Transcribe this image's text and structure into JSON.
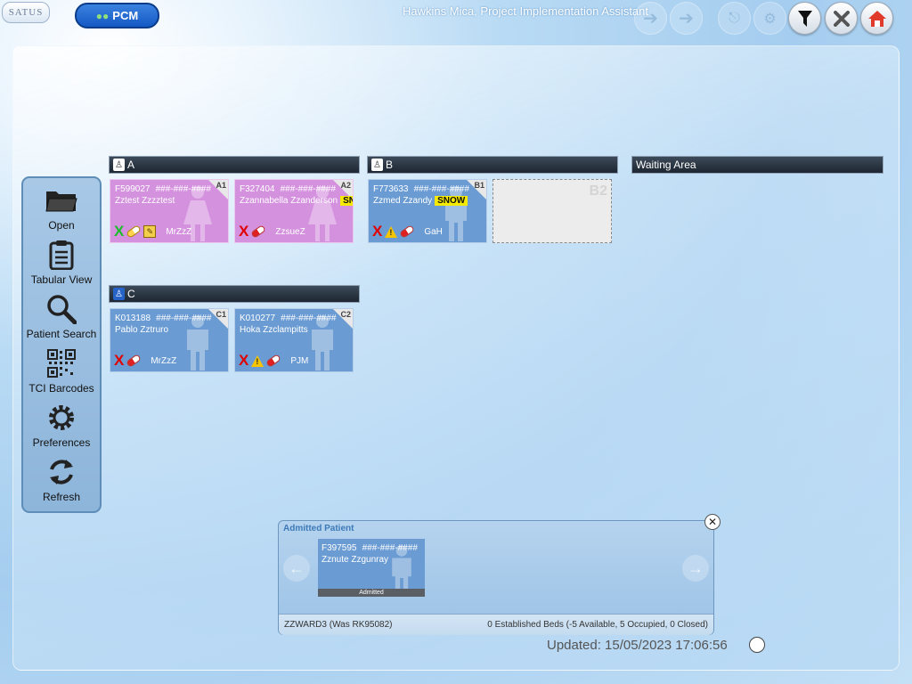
{
  "app": {
    "logo_text": "SATUS",
    "module_button": "PCM",
    "user_title": "Hawkins Mica, Project Implementation Assistant"
  },
  "toolbar": [
    {
      "icon": "back-arrow-icon",
      "state": "disabled"
    },
    {
      "icon": "forward-arrow-icon",
      "state": "disabled"
    },
    {
      "icon": "logout-icon",
      "state": "disabled"
    },
    {
      "icon": "tools-icon",
      "state": "disabled"
    },
    {
      "icon": "filter-icon",
      "state": "enabled"
    },
    {
      "icon": "close-icon",
      "state": "enabled"
    },
    {
      "icon": "home-icon",
      "state": "enabled"
    }
  ],
  "sidemenu": [
    {
      "label": "Open",
      "icon": "folder-icon"
    },
    {
      "label": "Tabular View",
      "icon": "clipboard-icon"
    },
    {
      "label": "Patient Search",
      "icon": "magnifier-icon"
    },
    {
      "label": "TCI Barcodes",
      "icon": "qr-code-icon"
    },
    {
      "label": "Preferences",
      "icon": "gear-icon"
    },
    {
      "label": "Refresh",
      "icon": "refresh-icon"
    }
  ],
  "rooms": {
    "A": {
      "name": "A"
    },
    "B": {
      "name": "B"
    },
    "waiting": {
      "name": "Waiting Area"
    },
    "C": {
      "name": "C"
    }
  },
  "beds": [
    {
      "bed": "A1",
      "mrn": "F599027",
      "nhs": "###-###-####",
      "name": "Zztest Zzzztest",
      "flag": "",
      "consultant": "MrZzZ",
      "gender": "female"
    },
    {
      "bed": "A2",
      "mrn": "F327404",
      "nhs": "###-###-####",
      "name": "Zzannabella Zzanderson",
      "flag": "SN",
      "consultant": "ZzsueZ",
      "gender": "female"
    },
    {
      "bed": "B1",
      "mrn": "F773633",
      "nhs": "###-###-####",
      "name": "Zzmed Zzandy",
      "flag": "SNOW",
      "consultant": "GaH",
      "gender": "male"
    },
    {
      "bed": "B2",
      "mrn": "",
      "nhs": "",
      "name": "",
      "flag": "",
      "consultant": "",
      "gender": "empty"
    },
    {
      "bed": "C1",
      "mrn": "K013188",
      "nhs": "###-###-####",
      "name": "Pablo Zztruro",
      "flag": "",
      "consultant": "MrZzZ",
      "gender": "male"
    },
    {
      "bed": "C2",
      "mrn": "K010277",
      "nhs": "###-###-####",
      "name": "Hoka Zzclampitts",
      "flag": "",
      "consultant": "PJM",
      "gender": "male"
    }
  ],
  "admitted": {
    "title": "Admitted Patient",
    "patient": {
      "mrn": "F397595",
      "nhs": "###-###-####",
      "name": "Zznute Zzgunray",
      "status": "Admitted"
    },
    "ward": "ZZWARD3 (Was RK95082)",
    "summary": "0 Established Beds (-5 Available, 5 Occupied, 0 Closed)"
  },
  "updated": "Updated: 15/05/2023 17:06:56",
  "colors": {
    "female_bed": "#d491de",
    "male_bed": "#6a9bd3",
    "flag_yellow": "#f5ea00",
    "room_header": "#2a3543"
  }
}
